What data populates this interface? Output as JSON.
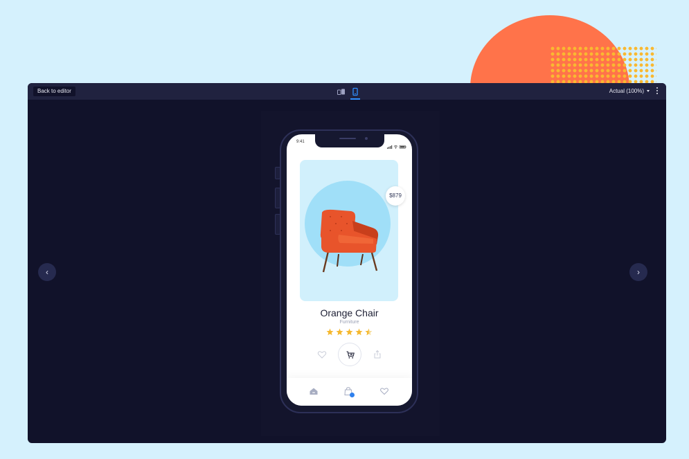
{
  "toolbar": {
    "back_label": "Back to editor",
    "zoom_label": "Actual (100%)",
    "devices": [
      {
        "name": "tablet-icon",
        "active": false
      },
      {
        "name": "phone-icon",
        "active": true
      }
    ]
  },
  "navigation": {
    "prev_icon": "‹",
    "next_icon": "›"
  },
  "phone": {
    "status_time": "9:41",
    "product": {
      "price": "$879",
      "title": "Orange Chair",
      "category": "Furniture",
      "rating": 4.5,
      "rating_max": 5
    },
    "tabs": [
      "home-icon",
      "shopping-bag-icon",
      "heart-icon"
    ],
    "active_tab": "shopping-bag-icon"
  },
  "colors": {
    "background": "#d5f1fd",
    "window": "#11122a",
    "toolbar": "#20223f",
    "accent": "#2f8fff",
    "blob": "#ff734a",
    "dots": "#f9b931",
    "star": "#f5b82e",
    "chair": "#e8542b"
  }
}
